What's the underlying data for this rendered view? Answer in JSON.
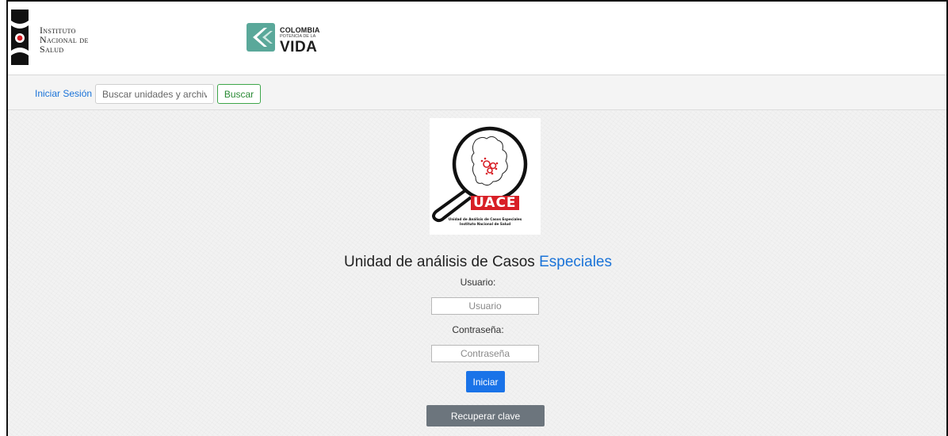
{
  "header": {
    "ins_logo_lines": [
      "Instituto",
      "Nacional de",
      "Salud"
    ],
    "colombia_logo": {
      "line1": "COLOMBIA",
      "line2": "POTENCIA DE LA",
      "line3": "VIDA"
    }
  },
  "navbar": {
    "login_link": "Iniciar Sesión",
    "search_placeholder": "Buscar unidades y archivos",
    "search_button": "Buscar"
  },
  "main": {
    "logo": {
      "wordmark": "UACE",
      "line1": "Unidad de Análisis de Casos Especiales",
      "line2": "Instituto Nacional de Salud"
    },
    "title_prefix": "Unidad de análisis de Casos",
    "title_accent": "Especiales",
    "user_label": "Usuario:",
    "user_placeholder": "Usuario",
    "password_label": "Contraseña:",
    "password_placeholder": "Contraseña",
    "login_button": "Iniciar",
    "recover_button": "Recuperar clave"
  },
  "colors": {
    "accent_blue": "#1a73d8",
    "success_green": "#3ea64a",
    "secondary_gray": "#6c757d",
    "uace_red": "#d81f26"
  }
}
